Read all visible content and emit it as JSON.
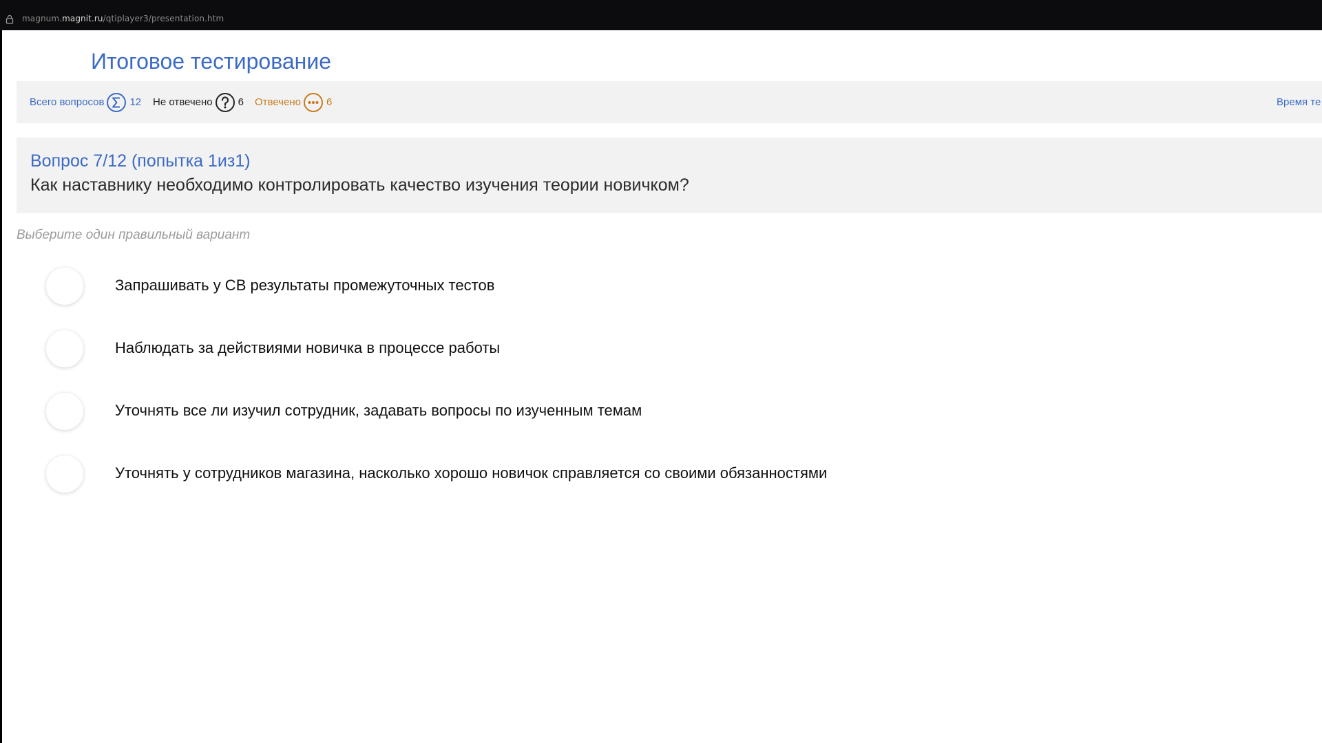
{
  "browser": {
    "url_prefix": "magnum.",
    "url_domain": "magnit.ru",
    "url_path": "/qtiplayer3/presentation.htm"
  },
  "page": {
    "title": "Итоговое тестирование"
  },
  "stats": {
    "total_label": "Всего вопросов",
    "total_value": "12",
    "unanswered_label": "Не отвечено",
    "unanswered_value": "6",
    "answered_label": "Отвечено",
    "answered_value": "6",
    "time_label": "Время те"
  },
  "question": {
    "number": "Вопрос 7/12  (попытка 1из1)",
    "text": "Как наставнику необходимо контролировать качество изучения теории новичком?"
  },
  "hint": "Выберите один правильный вариант",
  "options": [
    {
      "label": "Запрашивать у СВ результаты промежуточных тестов"
    },
    {
      "label": "Наблюдать за действиями новичка в процессе работы"
    },
    {
      "label": "Уточнять все ли изучил сотрудник, задавать вопросы по изученным темам"
    },
    {
      "label": "Уточнять у сотрудников магазина, насколько хорошо новичок справляется со своими обязанностями"
    }
  ],
  "colors": {
    "accent_blue": "#3c6bc5",
    "answered_orange": "#c97a1c",
    "panel_gray": "#f2f2f2"
  },
  "icons": [
    "lock-icon",
    "sigma-icon",
    "question-mark-icon",
    "ellipsis-icon"
  ]
}
